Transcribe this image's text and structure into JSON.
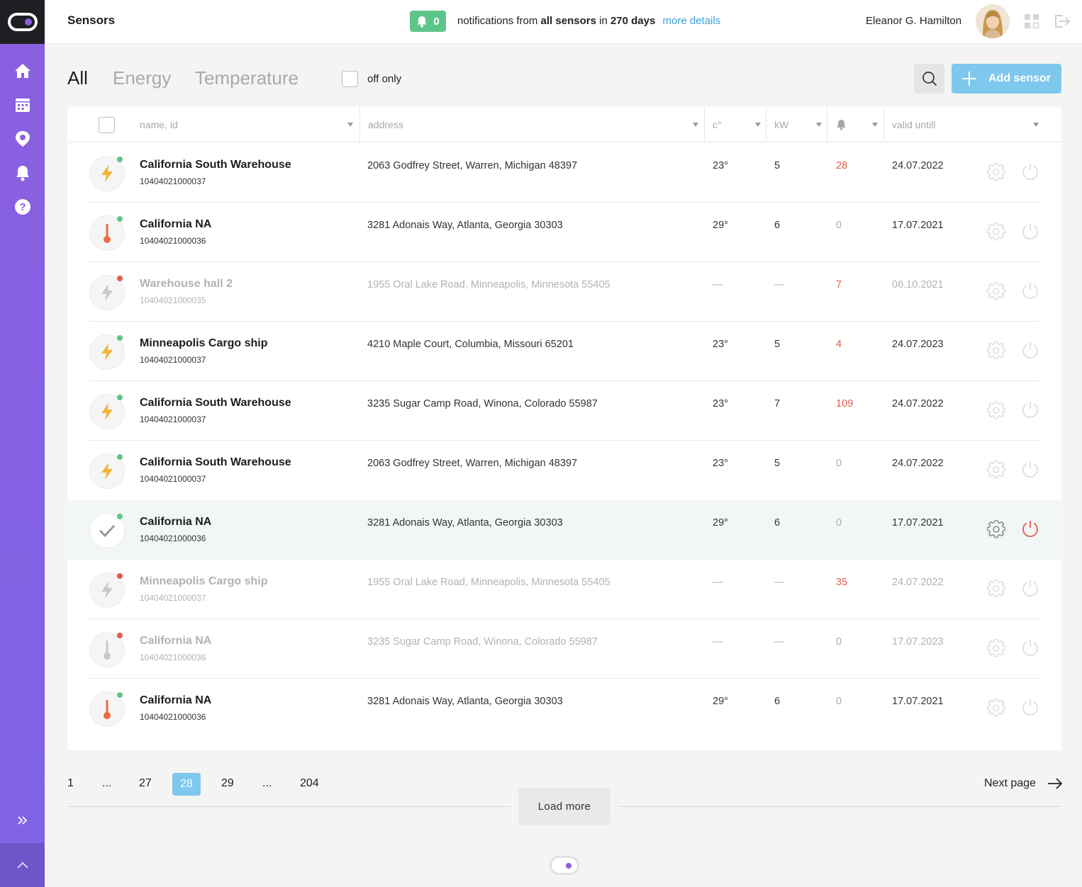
{
  "header": {
    "title": "Sensors",
    "notif_count": "0",
    "notif_text_1": "notifications from ",
    "notif_text_bold_1": "all sensors",
    "notif_text_2": " in ",
    "notif_text_bold_2": "270 days",
    "more_details": "more details",
    "user_name": "Eleanor G. Hamilton"
  },
  "filters": {
    "tabs": [
      "All",
      "Energy",
      "Temperature"
    ],
    "active_tab": "All",
    "off_only_label": "off only",
    "add_button": "Add sensor"
  },
  "table": {
    "columns": {
      "name": "name, id",
      "address": "address",
      "temp": "c°",
      "kw": "kW",
      "valid": "valid untill"
    },
    "rows": [
      {
        "name": "California South Warehouse",
        "id": "10404021000037",
        "address": "2063 Godfrey Street, Warren, Michigan 48397",
        "temp": "23°",
        "kw": "5",
        "notif": "28",
        "valid": "24.07.2022",
        "type": "energy",
        "status": "on"
      },
      {
        "name": "California NA",
        "id": "10404021000036",
        "address": "3281 Adonais Way, Atlanta, Georgia 30303",
        "temp": "29°",
        "kw": "6",
        "notif": "0",
        "valid": "17.07.2021",
        "type": "temperature",
        "status": "on"
      },
      {
        "name": "Warehouse hall 2",
        "id": "10404021000035",
        "address": "1955 Oral Lake Road, Minneapolis, Minnesota 55405",
        "temp": "—",
        "kw": "—",
        "notif": "7",
        "valid": "06.10.2021",
        "type": "energy",
        "status": "off"
      },
      {
        "name": "Minneapolis Cargo ship",
        "id": "10404021000037",
        "address": "4210 Maple Court, Columbia, Missouri 65201",
        "temp": "23°",
        "kw": "5",
        "notif": "4",
        "valid": "24.07.2023",
        "type": "energy",
        "status": "on"
      },
      {
        "name": "California South Warehouse",
        "id": "10404021000037",
        "address": "3235 Sugar Camp Road, Winona, Colorado 55987",
        "temp": "23°",
        "kw": "7",
        "notif": "109",
        "valid": "24.07.2022",
        "type": "energy",
        "status": "on"
      },
      {
        "name": "California South Warehouse",
        "id": "10404021000037",
        "address": "2063 Godfrey Street, Warren, Michigan 48397",
        "temp": "23°",
        "kw": "5",
        "notif": "0",
        "valid": "24.07.2022",
        "type": "energy",
        "status": "on"
      },
      {
        "name": "California NA",
        "id": "10404021000036",
        "address": "3281 Adonais Way, Atlanta, Georgia 30303",
        "temp": "29°",
        "kw": "6",
        "notif": "0",
        "valid": "17.07.2021",
        "type": "selected",
        "status": "on"
      },
      {
        "name": "Minneapolis Cargo ship",
        "id": "10404021000037",
        "address": "1955 Oral Lake Road, Minneapolis, Minnesota 55405",
        "temp": "—",
        "kw": "—",
        "notif": "35",
        "valid": "24.07.2022",
        "type": "energy",
        "status": "off"
      },
      {
        "name": "California NA",
        "id": "10404021000036",
        "address": "3235 Sugar Camp Road, Winona, Colorado 55987",
        "temp": "—",
        "kw": "—",
        "notif": "0",
        "valid": "17.07.2023",
        "type": "temperature",
        "status": "off"
      },
      {
        "name": "California NA",
        "id": "10404021000036",
        "address": "3281 Adonais Way, Atlanta, Georgia 30303",
        "temp": "29°",
        "kw": "6",
        "notif": "0",
        "valid": "17.07.2021",
        "type": "temperature",
        "status": "on"
      }
    ]
  },
  "pagination": {
    "p1": "1",
    "dots1": "...",
    "p27": "27",
    "p28": "28",
    "p29": "29",
    "dots2": "...",
    "p204": "204",
    "next": "Next page",
    "load_more": "Load more"
  },
  "colors": {
    "accent": "#8a5fe0",
    "button_blue": "#7dc8ec",
    "notif_green": "#5ec58a",
    "alert_red": "#e35a4a",
    "energy_yellow": "#f2b53a",
    "temp_orange": "#ee6a45"
  },
  "icons": {
    "sidebar": [
      "home-icon",
      "calendar-icon",
      "location-pin-icon",
      "bell-icon",
      "help-icon"
    ],
    "header": [
      "bell-icon",
      "grid-icon",
      "logout-icon"
    ],
    "row": [
      "lightning-icon",
      "thermometer-icon",
      "checkmark-icon",
      "gear-icon",
      "power-icon"
    ]
  }
}
